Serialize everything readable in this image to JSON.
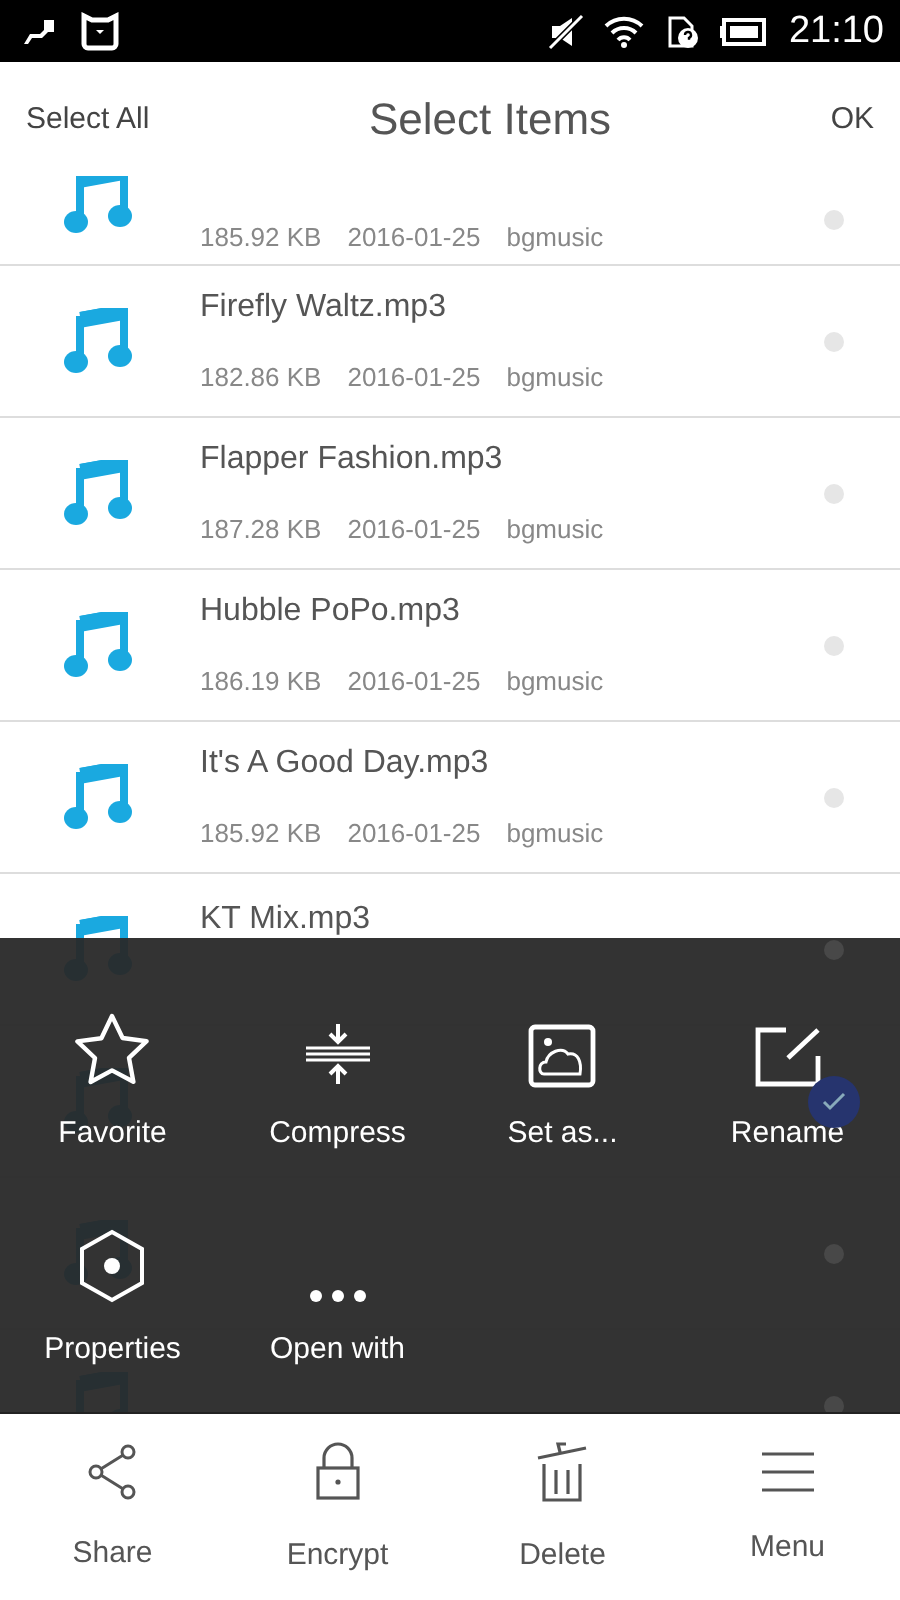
{
  "status_bar": {
    "time": "21:10"
  },
  "header": {
    "left": "Select All",
    "title": "Select Items",
    "right": "OK"
  },
  "files": [
    {
      "size": "185.92 KB",
      "date": "2016-01-25",
      "folder": "bgmusic",
      "selected": false
    },
    {
      "name": "Firefly Waltz.mp3",
      "size": "182.86 KB",
      "date": "2016-01-25",
      "folder": "bgmusic",
      "selected": false
    },
    {
      "name": "Flapper Fashion.mp3",
      "size": "187.28 KB",
      "date": "2016-01-25",
      "folder": "bgmusic",
      "selected": false
    },
    {
      "name": "Hubble PoPo.mp3",
      "size": "186.19 KB",
      "date": "2016-01-25",
      "folder": "bgmusic",
      "selected": false
    },
    {
      "name": "It's A Good Day.mp3",
      "size": "185.92 KB",
      "date": "2016-01-25",
      "folder": "bgmusic",
      "selected": false
    },
    {
      "name": "KT Mix.mp3",
      "selected": false
    },
    {
      "selected": true
    },
    {
      "selected": false
    },
    {
      "selected": false
    }
  ],
  "popup_actions": [
    {
      "kind": "star",
      "label": "Favorite"
    },
    {
      "kind": "compress",
      "label": "Compress"
    },
    {
      "kind": "image",
      "label": "Set as..."
    },
    {
      "kind": "rename",
      "label": "Rename"
    },
    {
      "kind": "properties",
      "label": "Properties"
    },
    {
      "kind": "more",
      "label": "Open with"
    }
  ],
  "bottom_bar": [
    {
      "kind": "share",
      "label": "Share"
    },
    {
      "kind": "lock",
      "label": "Encrypt"
    },
    {
      "kind": "trash",
      "label": "Delete"
    },
    {
      "kind": "menu",
      "label": "Menu"
    }
  ]
}
